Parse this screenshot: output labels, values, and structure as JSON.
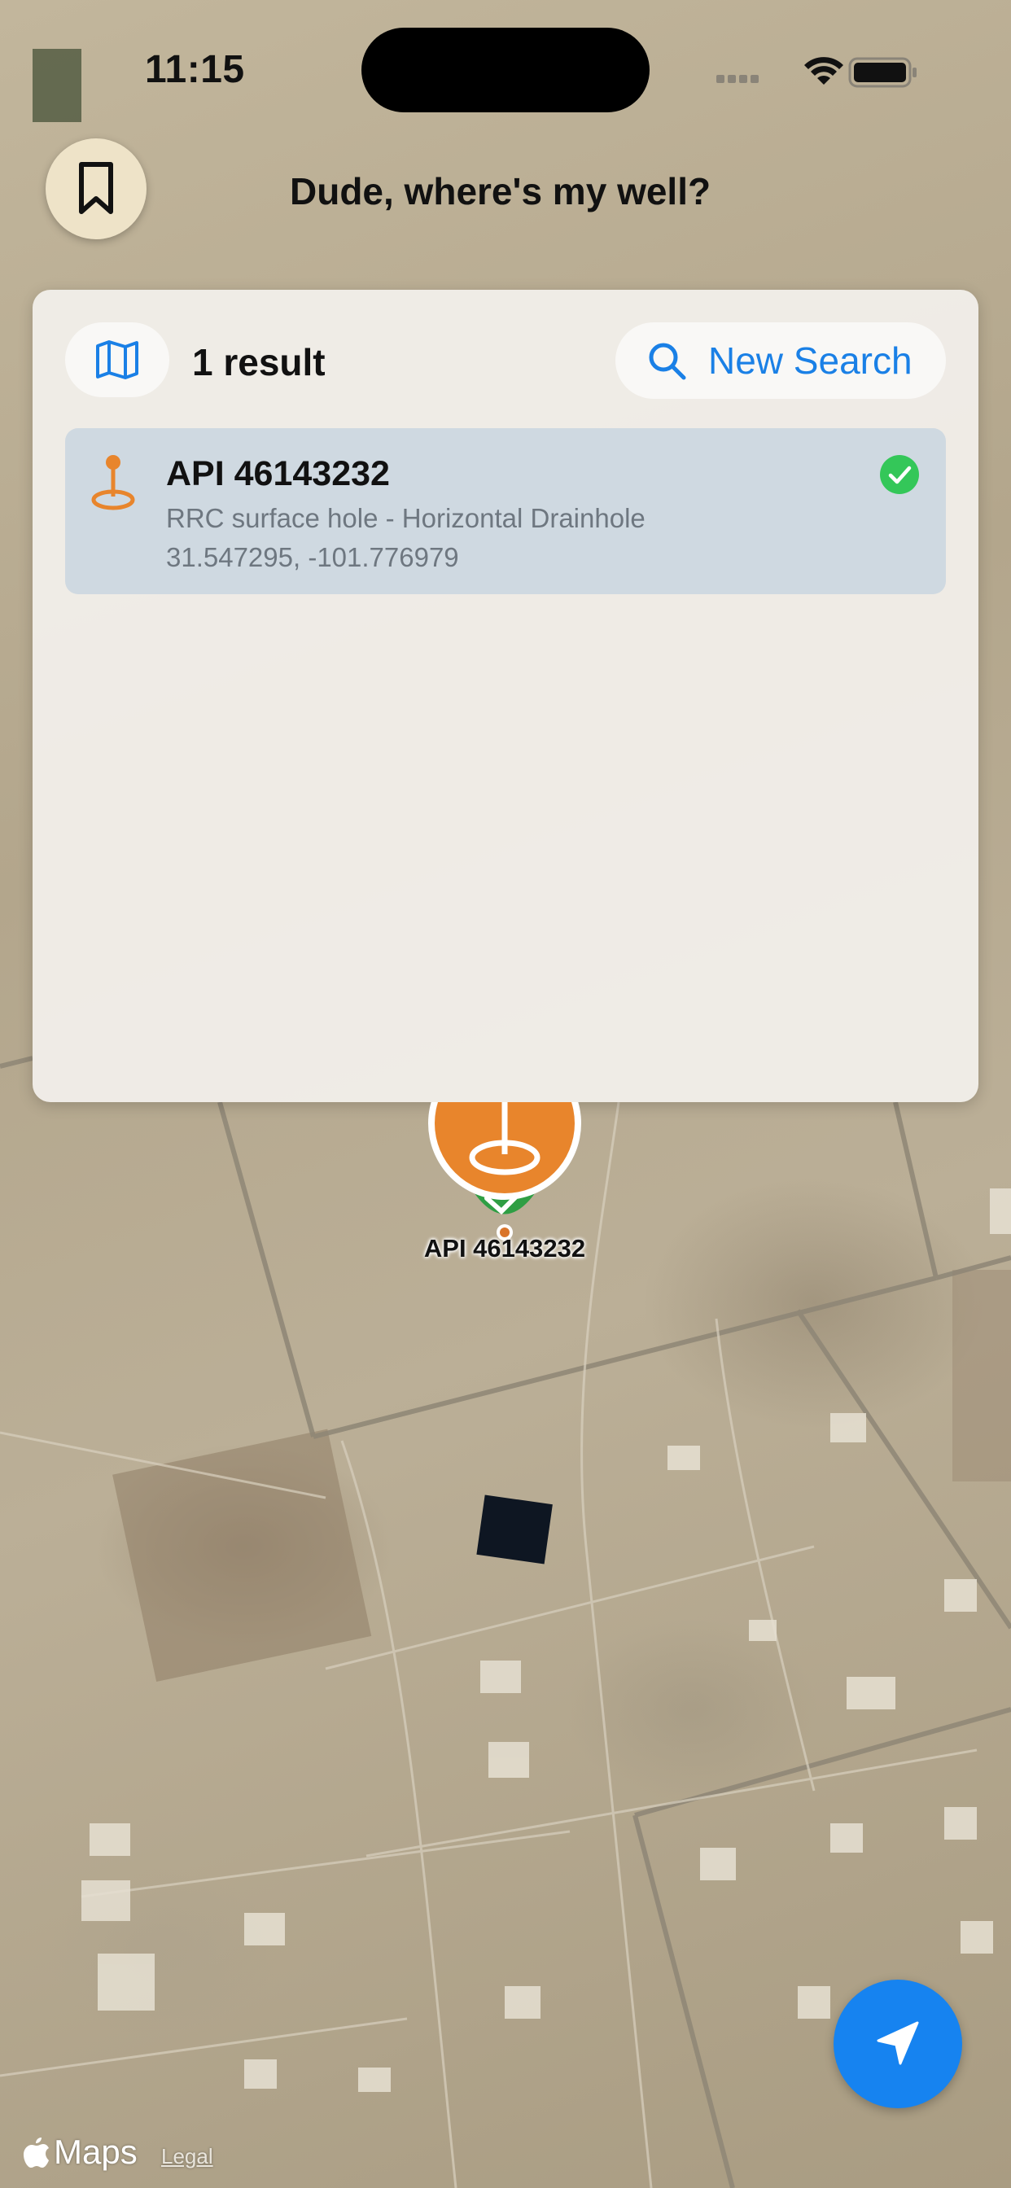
{
  "status_bar": {
    "time": "11:15"
  },
  "header": {
    "title": "Dude, where's my well?",
    "bookmark_icon": "bookmark-icon"
  },
  "results_panel": {
    "count_label": "1 result",
    "map_toggle_icon": "map-icon",
    "new_search": {
      "label": "New Search",
      "icon": "search-icon"
    },
    "results": [
      {
        "title": "API 46143232",
        "subtitle": "RRC surface hole - Horizontal Drainhole",
        "coordinates": "31.547295, -101.776979",
        "selected": true
      }
    ]
  },
  "map": {
    "marker_label": "API 46143232",
    "attribution": {
      "brand": "Maps",
      "legal": "Legal"
    }
  },
  "colors": {
    "accent": "#1683f0",
    "marker_orange": "#e8852c",
    "selected_row": "#cfd9e1",
    "check_green": "#34c759"
  }
}
